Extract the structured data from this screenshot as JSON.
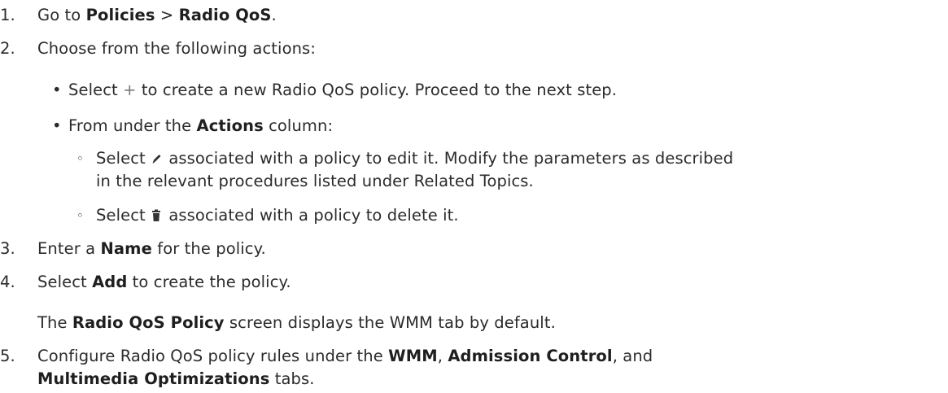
{
  "steps": {
    "s1": {
      "num": "1.",
      "pre": "Go to ",
      "b1": "Policies",
      "sep": " > ",
      "b2": "Radio QoS",
      "post": "."
    },
    "s2": {
      "num": "2.",
      "text": "Choose from the following actions:"
    },
    "s2a": {
      "bullet": "•",
      "pre": "Select ",
      "plus": "+",
      "post": " to create a new Radio QoS policy. Proceed to the next step."
    },
    "s2b": {
      "bullet": "•",
      "pre": "From under the ",
      "b": "Actions",
      "post": " column:"
    },
    "s2b1": {
      "bullet": "◦",
      "pre": "Select ",
      "icon": "edit-pencil-icon",
      "post": " associated with a policy to edit it. Modify the parameters as described"
    },
    "s2b1_cont": "in the relevant procedures listed under Related Topics.",
    "s2b2": {
      "bullet": "◦",
      "pre": "Select ",
      "icon": "trash-icon",
      "post": " associated with a policy to delete it."
    },
    "s3": {
      "num": "3.",
      "pre": "Enter a ",
      "b": "Name",
      "post": " for the policy."
    },
    "s4": {
      "num": "4.",
      "pre": "Select ",
      "b": "Add",
      "post": " to create the policy."
    },
    "s4_note": {
      "pre": "The ",
      "b": "Radio QoS Policy",
      "post": " screen displays the WMM tab by default."
    },
    "s5": {
      "num": "5.",
      "pre": "Configure Radio QoS policy rules under the ",
      "b1": "WMM",
      "mid1": ", ",
      "b2": "Admission Control",
      "mid2": ", and"
    },
    "s5_cont": {
      "b": "Multimedia Optimizations",
      "post": " tabs."
    }
  }
}
